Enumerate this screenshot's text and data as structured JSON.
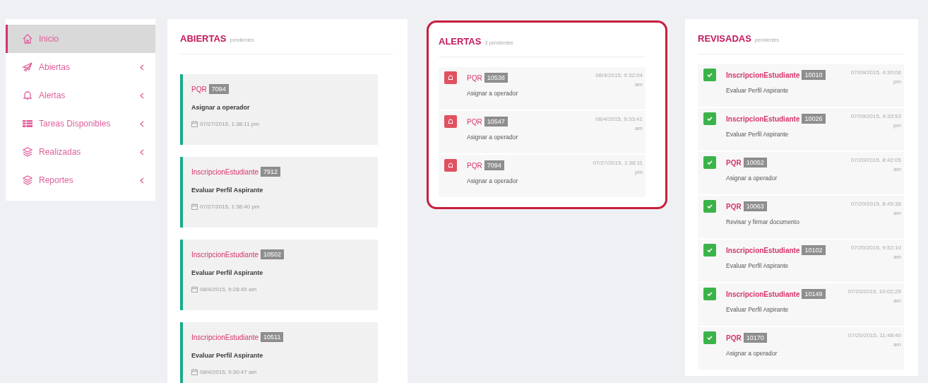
{
  "sidebar": {
    "items": [
      {
        "label": "Inicio",
        "selected": true,
        "has_submenu": false
      },
      {
        "label": "Abiertas",
        "selected": false,
        "has_submenu": true
      },
      {
        "label": "Alertas",
        "selected": false,
        "has_submenu": true
      },
      {
        "label": "Tareas Disponibles",
        "selected": false,
        "has_submenu": true
      },
      {
        "label": "Realizadas",
        "selected": false,
        "has_submenu": true
      },
      {
        "label": "Reportes",
        "selected": false,
        "has_submenu": true
      }
    ]
  },
  "panels": [
    {
      "title": "ABIERTAS",
      "subtitle": "pendientes",
      "kind": "open",
      "highlighted": false,
      "items": [
        {
          "process": "PQR",
          "number": "7094",
          "task": "Asignar a operador",
          "date": "07/27/2015, 1:38:11 pm"
        },
        {
          "process": "InscripcionEstudiante",
          "number": "7912",
          "task": "Evaluar Perfil Aspirante",
          "date": "07/27/2015, 1:38:40 pm"
        },
        {
          "process": "InscripcionEstudiante",
          "number": "10502",
          "task": "Evaluar Perfil Aspirante",
          "date": "08/4/2015, 9:28:45 am"
        },
        {
          "process": "InscripcionEstudiante",
          "number": "10511",
          "task": "Evaluar Perfil Aspirante",
          "date": "08/4/2015, 9:30:47 am"
        }
      ]
    },
    {
      "title": "ALERTAS",
      "subtitle": "3 pendientes",
      "kind": "alert",
      "highlighted": true,
      "items": [
        {
          "process": "PQR",
          "number": "10538",
          "task": "Asignar a operador",
          "date": "08/4/2015, 9:32:04 am"
        },
        {
          "process": "PQR",
          "number": "10547",
          "task": "Asignar a operador",
          "date": "08/4/2015, 9:33:41 am"
        },
        {
          "process": "PQR",
          "number": "7094",
          "task": "Asignar a operador",
          "date": "07/27/2015, 1:38:11 pm"
        }
      ]
    },
    {
      "title": "REVISADAS",
      "subtitle": "pendientes",
      "kind": "reviewed",
      "highlighted": false,
      "items": [
        {
          "process": "InscripcionEstudiante",
          "number": "10010",
          "task": "Evaluar Perfil Aspirante",
          "date": "07/09/2015, 4:30:06 pm"
        },
        {
          "process": "InscripcionEstudiante",
          "number": "10026",
          "task": "Evaluar Perfil Aspirante",
          "date": "07/09/2015, 4:33:53 pm"
        },
        {
          "process": "PQR",
          "number": "10052",
          "task": "Asignar a operador",
          "date": "07/20/2015, 8:42:05 am"
        },
        {
          "process": "PQR",
          "number": "10063",
          "task": "Revisar y firmar documento",
          "date": "07/20/2015, 8:45:38 am"
        },
        {
          "process": "InscripcionEstudiante",
          "number": "10102",
          "task": "Evaluar Perfil Aspirante",
          "date": "07/20/2015, 9:52:10 am"
        },
        {
          "process": "InscripcionEstudiante",
          "number": "10149",
          "task": "Evaluar Perfil Aspirante",
          "date": "07/20/2015, 10:02:25 am"
        },
        {
          "process": "PQR",
          "number": "10170",
          "task": "Asignar a operador",
          "date": "07/20/2015, 11:48:40 am"
        }
      ]
    }
  ]
}
